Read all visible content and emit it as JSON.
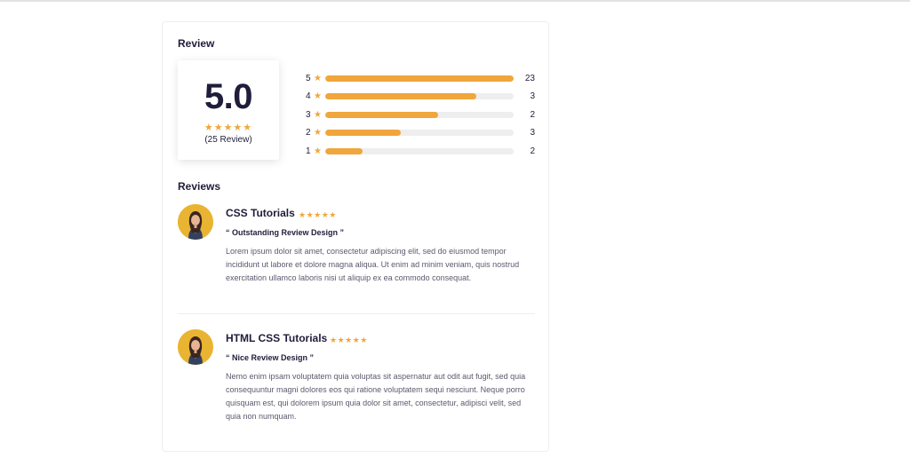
{
  "summary": {
    "heading": "Review",
    "score": "5.0",
    "stars": "★★★★★",
    "count_text": "(25 Review)"
  },
  "breakdown": [
    {
      "rating": "5",
      "count": "23",
      "fill_fraction": 1.0
    },
    {
      "rating": "4",
      "count": "3",
      "fill_fraction": 0.8
    },
    {
      "rating": "3",
      "count": "2",
      "fill_fraction": 0.6
    },
    {
      "rating": "2",
      "count": "3",
      "fill_fraction": 0.4
    },
    {
      "rating": "1",
      "count": "2",
      "fill_fraction": 0.2
    }
  ],
  "reviews_heading": "Reviews",
  "reviews": [
    {
      "name": "CSS Tutorials",
      "stars": "★★★★★",
      "headline": "“ Outstanding Review Design ”",
      "body": "Lorem ipsum dolor sit amet, consectetur adipiscing elit, sed do eiusmod tempor incididunt ut labore et dolore magna aliqua. Ut enim ad minim veniam, quis nostrud exercitation ullamco laboris nisi ut aliquip ex ea commodo consequat."
    },
    {
      "name": "HTML CSS Tutorials",
      "stars": "★★★★★",
      "headline": "“ Nice Review Design ”",
      "body": "Nemo enim ipsam voluptatem quia voluptas sit aspernatur aut odit aut fugit, sed quia consequuntur magni dolores eos qui ratione voluptatem sequi nesciunt. Neque porro quisquam est, qui dolorem ipsum quia dolor sit amet, consectetur, adipisci velit, sed quia non numquam."
    }
  ],
  "colors": {
    "accent": "#f0a63c",
    "text": "#1f1d3a",
    "muted": "#5a5a6e",
    "track": "#eeeeee",
    "avatar_bg": "#e9b431"
  },
  "icons": {
    "rating_star": "star-icon",
    "avatar": "user-avatar"
  }
}
